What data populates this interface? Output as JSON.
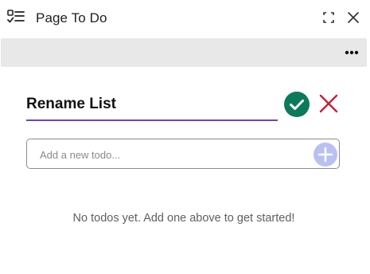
{
  "window": {
    "title": "Page To Do",
    "icons": {
      "app": "checklist-icon",
      "expand": "expand-icon",
      "close": "close-icon"
    }
  },
  "toolbar": {
    "more_icon": "more-horizontal-icon"
  },
  "rename": {
    "value": "Rename List",
    "confirm_icon": "check-circle-icon",
    "cancel_icon": "x-icon"
  },
  "new_todo": {
    "placeholder": "Add a new todo...",
    "value": "",
    "add_icon": "plus-circle-icon"
  },
  "empty_state": {
    "message": "No todos yet. Add one above to get started!"
  },
  "colors": {
    "accent_underline": "#6b45c4",
    "confirm_green": "#0b7a5a",
    "cancel_red": "#c4203a",
    "add_disabled": "#b9c0f2",
    "toolbar_bg": "#e8e8e8"
  }
}
